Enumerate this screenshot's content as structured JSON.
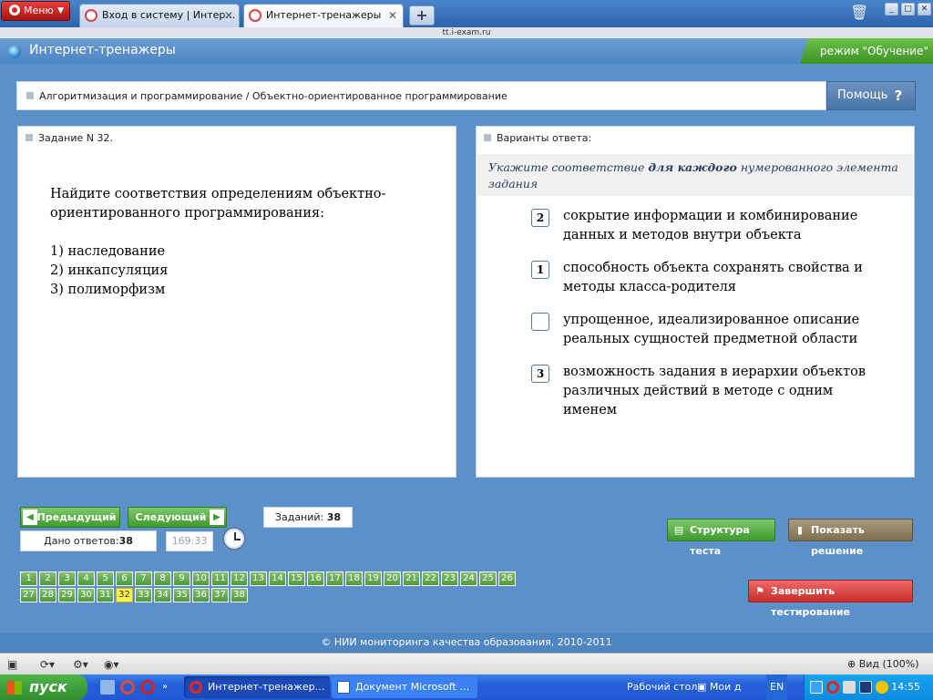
{
  "browser": {
    "menu_label": "Меню",
    "tabs": [
      {
        "label": "Вход в систему | Интер…",
        "close": "✕"
      },
      {
        "label": "Интернет-тренажеры",
        "close": "✕"
      }
    ],
    "new_tab": "+",
    "url": "tt.i-exam.ru"
  },
  "header": {
    "title": "Интернет-тренажеры",
    "mode": "режим \"Обучение\""
  },
  "topic": {
    "path": "Алгоритмизация и программирование / Объектно-ориентированное программирование",
    "help_label": "Помощь",
    "help_icon": "?"
  },
  "task": {
    "header": "Задание N 32.",
    "question_line1": "Найдите соответствия определениям объектно-",
    "question_line2": "ориентированного программирования:",
    "items": [
      "1) наследование",
      "2) инкапсуляция",
      "3) полиморфизм"
    ]
  },
  "answers": {
    "header": "Варианты ответа:",
    "instr_pre": "Укажите соответствие ",
    "instr_bold": "для каждого",
    "instr_post": " нумерованного элемента задания",
    "options": [
      {
        "value": "2",
        "text": "сокрытие информации и комбинирование данных и методов внутри объекта"
      },
      {
        "value": "1",
        "text": "способность объекта сохранять свойства и методы класса-родителя"
      },
      {
        "value": "",
        "text": "упрощенное, идеализированное описание реальных сущностей предметной области"
      },
      {
        "value": "3",
        "text": "возможность задания в иерархии объектов различных действий в методе с одним именем"
      }
    ]
  },
  "controls": {
    "prev_label": "Предыдущий",
    "next_label": "Следующий",
    "tasks_label": "Заданий: ",
    "tasks_count": "38",
    "answered_label": "Дано ответов:",
    "answered_count": "38",
    "timer": "169:33",
    "structure_label": "Структура теста",
    "solution_label": "Показать решение",
    "finish_label": "Завершить тестирование",
    "current_task": 32,
    "task_numbers": [
      "1",
      "2",
      "3",
      "4",
      "5",
      "6",
      "7",
      "8",
      "9",
      "10",
      "11",
      "12",
      "13",
      "14",
      "15",
      "16",
      "17",
      "18",
      "19",
      "20",
      "21",
      "22",
      "23",
      "24",
      "25",
      "26",
      "27",
      "28",
      "29",
      "30",
      "31",
      "32",
      "33",
      "34",
      "35",
      "36",
      "37",
      "38"
    ]
  },
  "footer": {
    "copyright": "© НИИ мониторинга качества образования, 2010-2011"
  },
  "statusbar": {
    "zoom": "Вид (100%)"
  },
  "taskbar": {
    "start_label": "пуск",
    "windows": [
      {
        "label": "Интернет-тренажер…"
      },
      {
        "label": "Документ Microsoft …"
      }
    ],
    "desktop_label": "Рабочий стол",
    "my_docs_label": "Мои д",
    "lang": "EN",
    "time": "14:55"
  }
}
